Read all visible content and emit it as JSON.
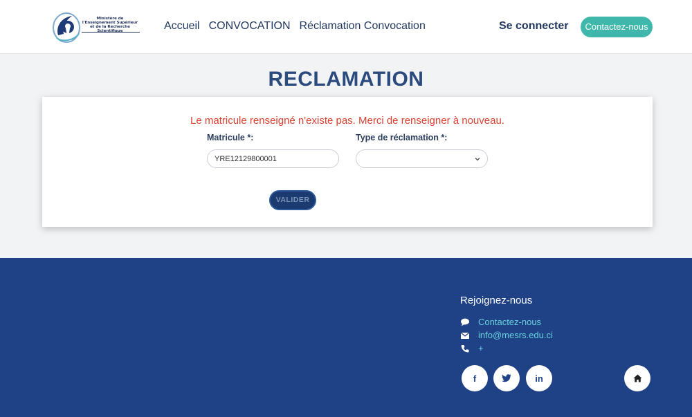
{
  "logo": {
    "text": "Ministère de l'Enseignement Supérieur et de la Recherche Scientifique",
    "icon": "ministry-emblem"
  },
  "nav": {
    "items": [
      "Accueil",
      "CONVOCATION",
      "Réclamation Convocation"
    ],
    "login": "Se connecter",
    "contact_button": "Contactez-nous"
  },
  "main": {
    "title": "RECLAMATION",
    "error_message": "Le matricule renseigné n'existe pas. Merci de renseigner à nouveau.",
    "matricule_label": "Matricule *:",
    "matricule_value": "YRE12129800001",
    "type_label": "Type de réclamation *:",
    "type_value": "",
    "submit_label": "VALIDER"
  },
  "footer": {
    "title": "Rejoignez-nous",
    "contact_link": "Contactez-nous",
    "email": "info@mesrs.edu.ci",
    "phone": "+",
    "social": [
      "facebook-icon",
      "twitter-icon",
      "linkedin-icon",
      "home-icon"
    ]
  },
  "colors": {
    "primary": "#1f4185",
    "accent": "#3fb7ab",
    "error": "#d8412f",
    "link": "#67d2dd"
  }
}
